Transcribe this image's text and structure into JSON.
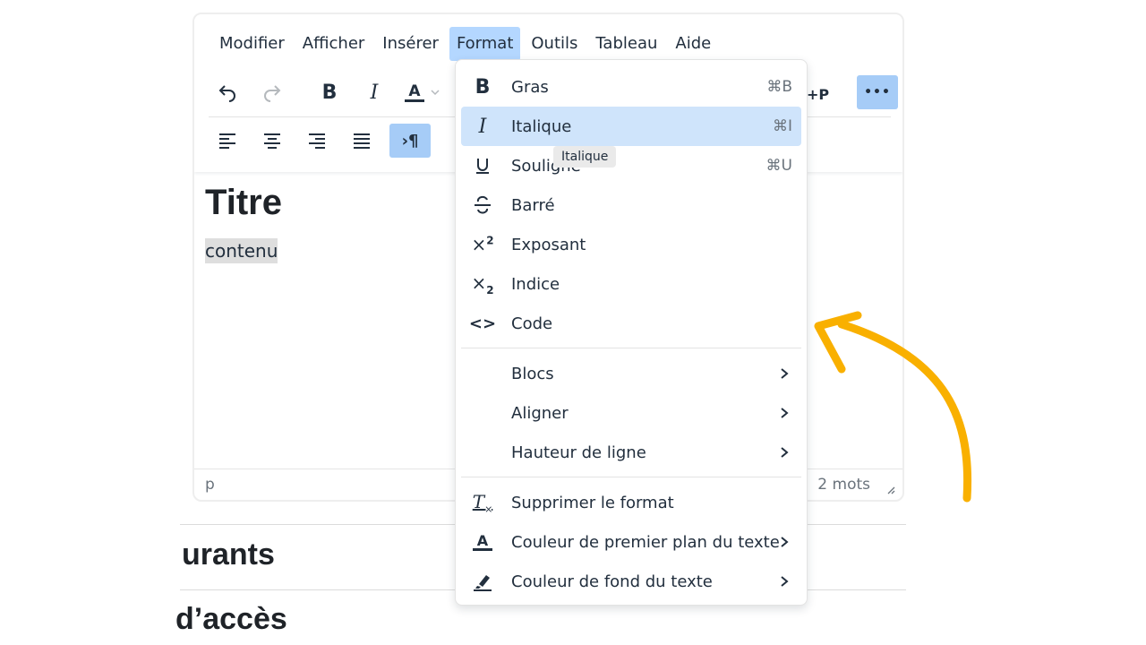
{
  "menubar": {
    "items": [
      "Modifier",
      "Afficher",
      "Insérer",
      "Format",
      "Outils",
      "Tableau",
      "Aide"
    ],
    "active": "Format"
  },
  "toolbar": {
    "undo": "undo-icon",
    "redo": "redo-icon",
    "bold": "B",
    "italic": "I",
    "text_color": "A",
    "more": "•••"
  },
  "content": {
    "title": "Titre",
    "paragraph": "contenu"
  },
  "statusbar": {
    "path": "p",
    "word_count": "2 mots"
  },
  "format_menu": {
    "items": [
      {
        "label": "Gras",
        "shortcut": "⌘B",
        "icon": "bold-icon"
      },
      {
        "label": "Italique",
        "shortcut": "⌘I",
        "icon": "italic-icon"
      },
      {
        "label": "Souligné",
        "shortcut": "⌘U",
        "icon": "underline-icon"
      },
      {
        "label": "Barré",
        "shortcut": "",
        "icon": "strikethrough-icon"
      },
      {
        "label": "Exposant",
        "shortcut": "",
        "icon": "superscript-icon"
      },
      {
        "label": "Indice",
        "shortcut": "",
        "icon": "subscript-icon"
      },
      {
        "label": "Code",
        "shortcut": "",
        "icon": "code-icon"
      },
      {
        "label": "Blocs",
        "submenu": true
      },
      {
        "label": "Aligner",
        "submenu": true
      },
      {
        "label": "Hauteur de ligne",
        "submenu": true
      },
      {
        "label": "Supprimer le format",
        "icon": "remove-format-icon"
      },
      {
        "label": "Couleur de premier plan du texte",
        "submenu": true,
        "icon": "text-color-icon"
      },
      {
        "label": "Couleur de fond du texte",
        "submenu": true,
        "icon": "highlighter-icon"
      }
    ],
    "highlighted": "Italique"
  },
  "tooltip": "Italique",
  "page": {
    "heading_1": "urants",
    "heading_2": "d’accès"
  },
  "colors": {
    "accent": "#a6ccf7",
    "highlight": "#cfe4fb",
    "arrow": "#f9b000"
  }
}
